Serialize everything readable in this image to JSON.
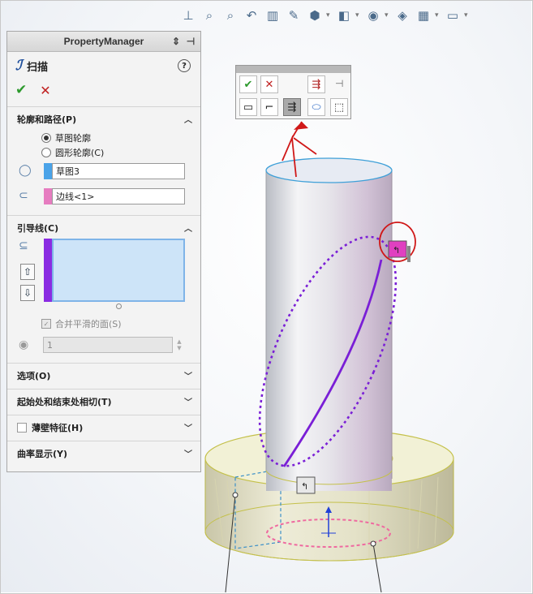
{
  "toolbar": {
    "icons": [
      "view-orientation-icon",
      "zoom-fit-icon",
      "zoom-area-icon",
      "previous-view-icon",
      "section-view-icon",
      "dynamic-annotation-icon",
      "view-orientation-cube-icon",
      "display-style-icon",
      "hide-show-icon",
      "edit-appearance-icon",
      "apply-scene-icon",
      "view-settings-icon"
    ]
  },
  "property_manager": {
    "title": "PropertyManager",
    "feature_name": "扫描",
    "sections": {
      "profile_path": {
        "title": "轮廓和路径(P)",
        "options": [
          "草图轮廓",
          "圆形轮廓(C)"
        ],
        "selected_option": "草图轮廓",
        "profile_value": "草图3",
        "path_value": "边线<1>"
      },
      "guide_curves": {
        "title": "引导线(C)",
        "merge_smooth_label": "合并平滑的面(S)",
        "count_value": "1"
      },
      "options": {
        "title": "选项(O)"
      },
      "tangency": {
        "title": "起始处和结束处相切(T)"
      },
      "thin_feature": {
        "title": "薄壁特征(H)"
      },
      "curvature": {
        "title": "曲率显示(Y)"
      }
    },
    "colors": {
      "profile_swatch": "#4aa3e8",
      "path_swatch": "#e67cc0",
      "guide_swatch": "#8a2be2"
    }
  },
  "selection_toolbar": {
    "buttons": [
      "ok-icon",
      "cancel-icon",
      "select-other-icon",
      "pin-icon",
      "closed-loop-icon",
      "open-loop-icon",
      "select-chain-icon",
      "select-region-icon",
      "box-select-icon"
    ]
  }
}
